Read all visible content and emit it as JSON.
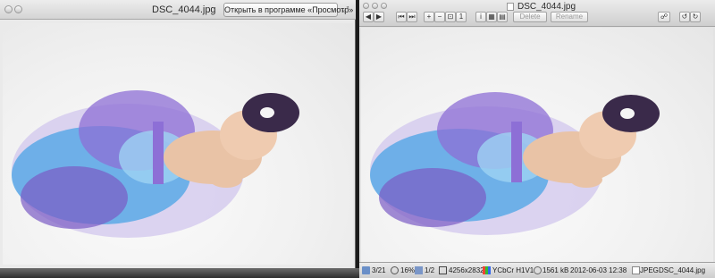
{
  "left_window": {
    "title": "DSC_4044.jpg",
    "open_button": "Открыть в программе «Просмотр»",
    "fullscreen_glyph": "⤢"
  },
  "right_window": {
    "title": "DSC_4044.jpg",
    "toolbar": {
      "prev_glyph": "◀",
      "next_glyph": "▶",
      "first_glyph": "⏮",
      "last_glyph": "⏭",
      "zoom_in_glyph": "+",
      "zoom_out_glyph": "−",
      "zoom_fit_glyph": "⊡",
      "zoom_actual_glyph": "1",
      "info_glyph": "i",
      "grid_glyph": "▦",
      "thumb_glyph": "▤",
      "delete_label": "Delete",
      "rename_label": "Rename",
      "share_glyph": "☍",
      "rotate_left_glyph": "↺",
      "rotate_right_glyph": "↻"
    },
    "status": {
      "position": "3/21",
      "zoom": "16%",
      "page": "1/2",
      "dimensions": "4256x2832",
      "color": "YCbCr H1V1",
      "size": "1561 kB",
      "date": "2012-06-03 12:38",
      "format": "JPEG",
      "filename": "DSC_4044.jpg"
    }
  },
  "colors": {
    "tutu_blue": "#5aa9e6",
    "tutu_purple": "#7a5bc4",
    "tutu_light": "#c9b8ea",
    "skin": "#e9c3a6",
    "hair": "#3a2a4a"
  }
}
